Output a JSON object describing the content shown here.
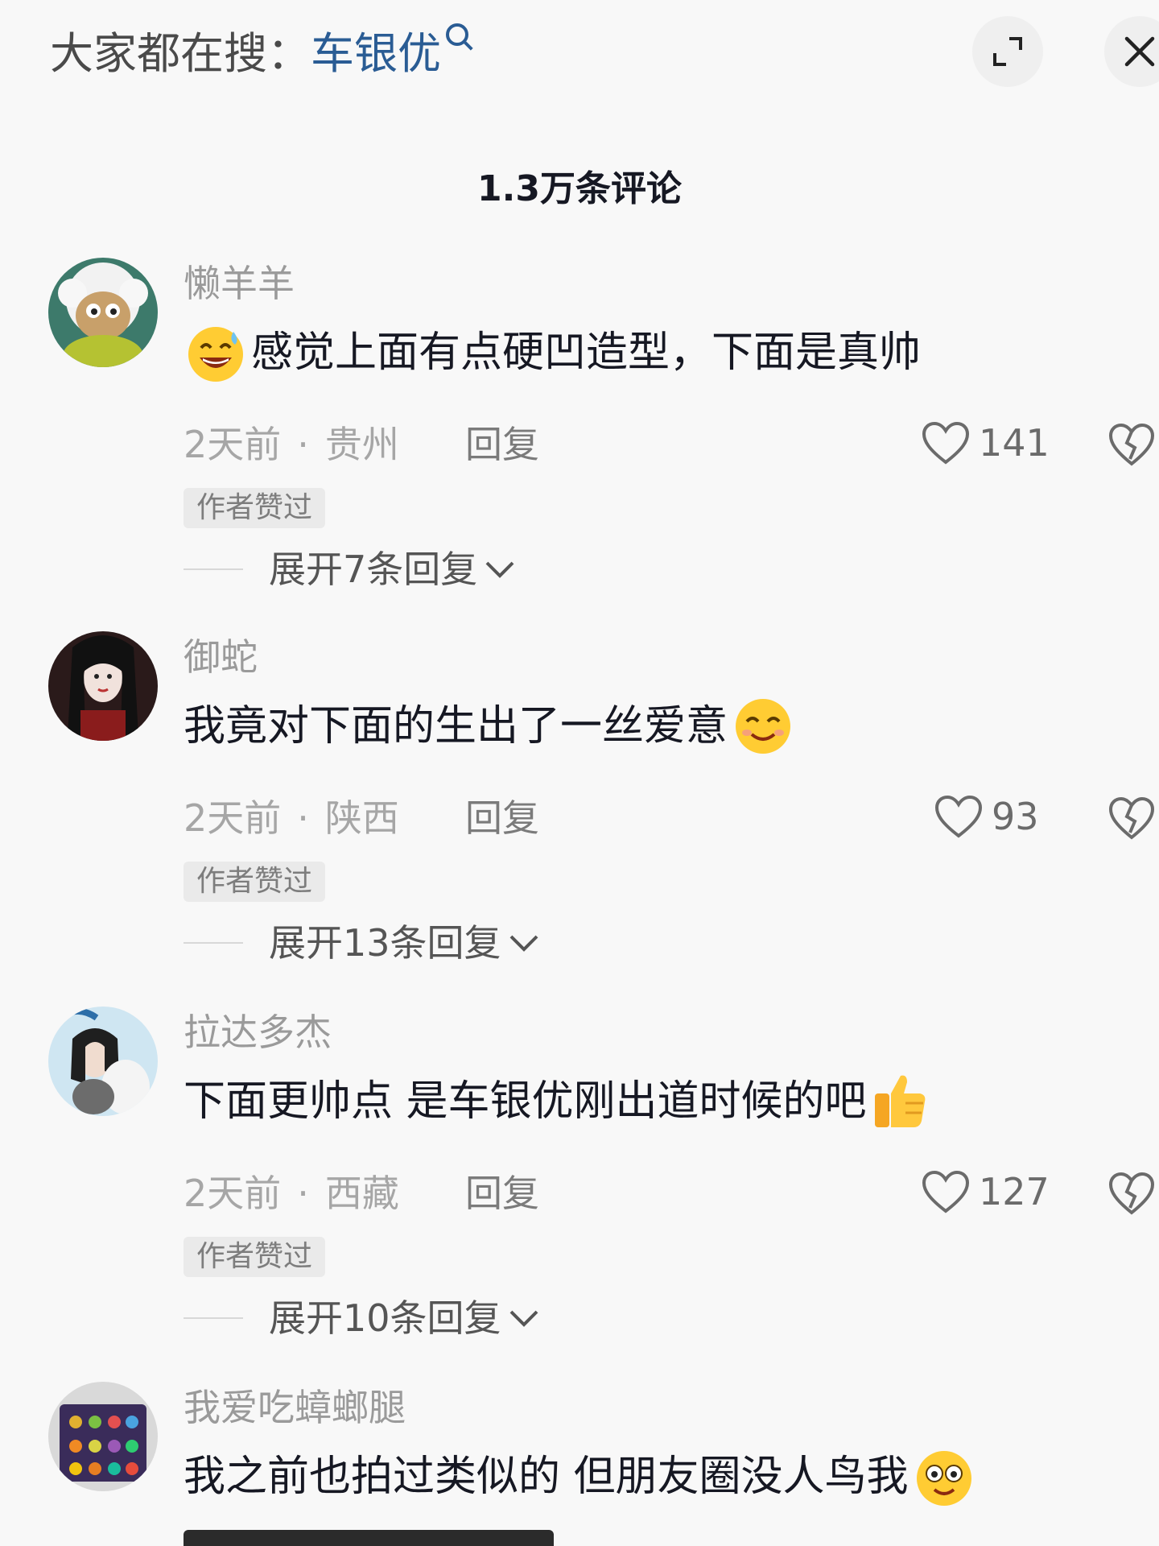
{
  "header": {
    "hot_search_prefix": "大家都在搜：",
    "hot_search_keyword": "车银优"
  },
  "comments_count": "1.3万条评论",
  "comments": [
    {
      "username": "懒羊羊",
      "text": "感觉上面有点硬凹造型，下面是真帅",
      "emoji": "grinning-sweat-emoji",
      "time": "2天前",
      "location": "贵州",
      "reply_label": "回复",
      "likes": "141",
      "badge": "作者赞过",
      "expand_label": "展开7条回复"
    },
    {
      "username": "御蛇",
      "text": "我竟对下面的生出了一丝爱意",
      "emoji": "smiling-emoji",
      "time": "2天前",
      "location": "陕西",
      "reply_label": "回复",
      "likes": "93",
      "badge": "作者赞过",
      "expand_label": "展开13条回复"
    },
    {
      "username": "拉达多杰",
      "text": "下面更帅点 是车银优刚出道时候的吧",
      "emoji": "thumbs-up-emoji",
      "time": "2天前",
      "location": "西藏",
      "reply_label": "回复",
      "likes": "127",
      "badge": "作者赞过",
      "expand_label": "展开10条回复"
    },
    {
      "username": "我爱吃蟑螂腿",
      "text": "我之前也拍过类似的 但朋友圈没人鸟我",
      "emoji": "goggle-eyes-emoji"
    }
  ],
  "colors": {
    "keyword_blue": "#2a5c94",
    "username_gray": "#9a9a9a",
    "text_dark": "#161823",
    "badge_bg": "#eaeaea"
  }
}
